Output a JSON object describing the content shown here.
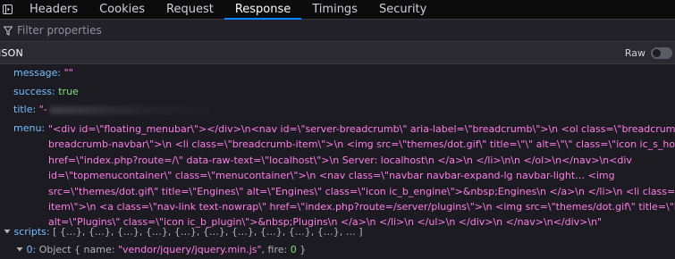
{
  "tabs": [
    "Headers",
    "Cookies",
    "Request",
    "Response",
    "Timings",
    "Security"
  ],
  "active_tab": "Response",
  "filter": {
    "placeholder": "Filter properties",
    "value": ""
  },
  "json_bar": {
    "label": "JSON",
    "raw_label": "Raw",
    "raw_enabled": false
  },
  "colors": {
    "accent": "#0a84ff",
    "key": "#75bfff",
    "string": "#ff7de9",
    "boolean": "#86de74"
  },
  "fields": {
    "message": {
      "key": "message:",
      "value": "\"\""
    },
    "success": {
      "key": "success:",
      "value": "true"
    },
    "title": {
      "key": "title:",
      "value": "\"-"
    },
    "menu": {
      "key": "menu:",
      "lines": [
        "\"<div id=\\\"floating_menubar\\\"></div>\\n<nav id=\\\"server-breadcrumb\\\" aria-label=\\\"breadcrumb\\\">\\n <ol class=\\\"breadcrumb",
        "breadcrumb-navbar\\\">\\n <li class=\\\"breadcrumb-item\\\">\\n <img src=\\\"themes/dot.gif\\\" title=\\\"\\\" alt=\\\"\\\" class=\\\"icon ic_s_host\\\">\\n <a",
        "href=\\\"index.php?route=/\\\" data-raw-text=\\\"localhost\\\">\\n Server: localhost\\n </a>\\n </li>\\n\\n </ol>\\n</nav>\\n<div",
        "id=\\\"topmenucontainer\\\" class=\\\"menucontainer\\\">\\n <nav class=\\\"navbar navbar-expand-lg navbar-light… <img",
        "src=\\\"themes/dot.gif\\\" title=\\\"Engines\\\" alt=\\\"Engines\\\" class=\\\"icon ic_b_engine\\\">&nbsp;Engines\\n </a>\\n </li>\\n <li class=\\\"nav-",
        "item\\\">\\n <a class=\\\"nav-link text-nowrap\\\" href=\\\"index.php?route=/server/plugins\\\">\\n <img src=\\\"themes/dot.gif\\\" title=\\\"Plugins\\\"",
        "alt=\\\"Plugins\\\" class=\\\"icon ic_b_plugin\\\">&nbsp;Plugins\\n </a>\\n </li>\\n </ul>\\n </div>\\n </nav>\\n</div>\\n\""
      ]
    },
    "scripts": {
      "key": "scripts:",
      "summary": "[ {…}, {…}, {…}, {…}, {…}, {…}, {…}, {…}, {…}, {…}, … ]",
      "item0": {
        "key": "0:",
        "type": "Object",
        "open": "{",
        "name_key": "name:",
        "name_value": "\"vendor/jquery/jquery.min.js\"",
        "fire_key": "fire:",
        "fire_value": "0",
        "close": "}"
      }
    }
  }
}
